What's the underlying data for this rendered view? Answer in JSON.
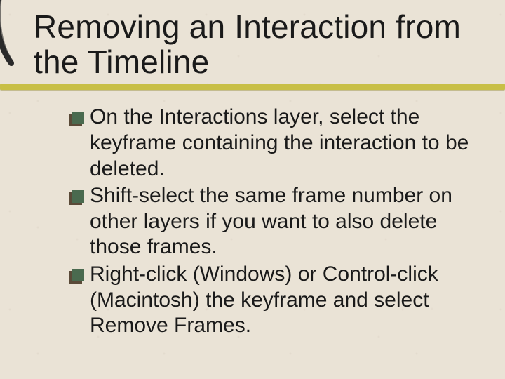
{
  "title": "Removing an Interaction from the Timeline",
  "bullets": [
    {
      "text": "On the Interactions layer, select the keyframe containing the interaction to be deleted."
    },
    {
      "text": "Shift-select the same frame number on other layers if you want to also delete those frames."
    },
    {
      "text": "Right-click (Windows) or Control-click (Macintosh) the keyframe and select Remove Frames."
    }
  ],
  "colors": {
    "background": "#eae3d6",
    "underline": "#c8bf46",
    "bullet_primary": "#4a6a4f",
    "bullet_shadow": "#5a4a38"
  }
}
